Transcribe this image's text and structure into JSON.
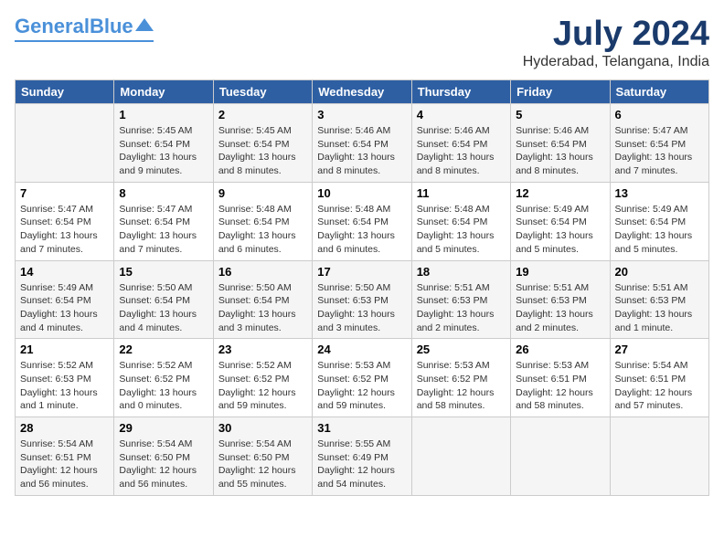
{
  "header": {
    "logo_general": "General",
    "logo_blue": "Blue",
    "month": "July 2024",
    "location": "Hyderabad, Telangana, India"
  },
  "columns": [
    "Sunday",
    "Monday",
    "Tuesday",
    "Wednesday",
    "Thursday",
    "Friday",
    "Saturday"
  ],
  "weeks": [
    [
      {
        "num": "",
        "info": ""
      },
      {
        "num": "1",
        "info": "Sunrise: 5:45 AM\nSunset: 6:54 PM\nDaylight: 13 hours\nand 9 minutes."
      },
      {
        "num": "2",
        "info": "Sunrise: 5:45 AM\nSunset: 6:54 PM\nDaylight: 13 hours\nand 8 minutes."
      },
      {
        "num": "3",
        "info": "Sunrise: 5:46 AM\nSunset: 6:54 PM\nDaylight: 13 hours\nand 8 minutes."
      },
      {
        "num": "4",
        "info": "Sunrise: 5:46 AM\nSunset: 6:54 PM\nDaylight: 13 hours\nand 8 minutes."
      },
      {
        "num": "5",
        "info": "Sunrise: 5:46 AM\nSunset: 6:54 PM\nDaylight: 13 hours\nand 8 minutes."
      },
      {
        "num": "6",
        "info": "Sunrise: 5:47 AM\nSunset: 6:54 PM\nDaylight: 13 hours\nand 7 minutes."
      }
    ],
    [
      {
        "num": "7",
        "info": "Sunrise: 5:47 AM\nSunset: 6:54 PM\nDaylight: 13 hours\nand 7 minutes."
      },
      {
        "num": "8",
        "info": "Sunrise: 5:47 AM\nSunset: 6:54 PM\nDaylight: 13 hours\nand 7 minutes."
      },
      {
        "num": "9",
        "info": "Sunrise: 5:48 AM\nSunset: 6:54 PM\nDaylight: 13 hours\nand 6 minutes."
      },
      {
        "num": "10",
        "info": "Sunrise: 5:48 AM\nSunset: 6:54 PM\nDaylight: 13 hours\nand 6 minutes."
      },
      {
        "num": "11",
        "info": "Sunrise: 5:48 AM\nSunset: 6:54 PM\nDaylight: 13 hours\nand 5 minutes."
      },
      {
        "num": "12",
        "info": "Sunrise: 5:49 AM\nSunset: 6:54 PM\nDaylight: 13 hours\nand 5 minutes."
      },
      {
        "num": "13",
        "info": "Sunrise: 5:49 AM\nSunset: 6:54 PM\nDaylight: 13 hours\nand 5 minutes."
      }
    ],
    [
      {
        "num": "14",
        "info": "Sunrise: 5:49 AM\nSunset: 6:54 PM\nDaylight: 13 hours\nand 4 minutes."
      },
      {
        "num": "15",
        "info": "Sunrise: 5:50 AM\nSunset: 6:54 PM\nDaylight: 13 hours\nand 4 minutes."
      },
      {
        "num": "16",
        "info": "Sunrise: 5:50 AM\nSunset: 6:54 PM\nDaylight: 13 hours\nand 3 minutes."
      },
      {
        "num": "17",
        "info": "Sunrise: 5:50 AM\nSunset: 6:53 PM\nDaylight: 13 hours\nand 3 minutes."
      },
      {
        "num": "18",
        "info": "Sunrise: 5:51 AM\nSunset: 6:53 PM\nDaylight: 13 hours\nand 2 minutes."
      },
      {
        "num": "19",
        "info": "Sunrise: 5:51 AM\nSunset: 6:53 PM\nDaylight: 13 hours\nand 2 minutes."
      },
      {
        "num": "20",
        "info": "Sunrise: 5:51 AM\nSunset: 6:53 PM\nDaylight: 13 hours\nand 1 minute."
      }
    ],
    [
      {
        "num": "21",
        "info": "Sunrise: 5:52 AM\nSunset: 6:53 PM\nDaylight: 13 hours\nand 1 minute."
      },
      {
        "num": "22",
        "info": "Sunrise: 5:52 AM\nSunset: 6:52 PM\nDaylight: 13 hours\nand 0 minutes."
      },
      {
        "num": "23",
        "info": "Sunrise: 5:52 AM\nSunset: 6:52 PM\nDaylight: 12 hours\nand 59 minutes."
      },
      {
        "num": "24",
        "info": "Sunrise: 5:53 AM\nSunset: 6:52 PM\nDaylight: 12 hours\nand 59 minutes."
      },
      {
        "num": "25",
        "info": "Sunrise: 5:53 AM\nSunset: 6:52 PM\nDaylight: 12 hours\nand 58 minutes."
      },
      {
        "num": "26",
        "info": "Sunrise: 5:53 AM\nSunset: 6:51 PM\nDaylight: 12 hours\nand 58 minutes."
      },
      {
        "num": "27",
        "info": "Sunrise: 5:54 AM\nSunset: 6:51 PM\nDaylight: 12 hours\nand 57 minutes."
      }
    ],
    [
      {
        "num": "28",
        "info": "Sunrise: 5:54 AM\nSunset: 6:51 PM\nDaylight: 12 hours\nand 56 minutes."
      },
      {
        "num": "29",
        "info": "Sunrise: 5:54 AM\nSunset: 6:50 PM\nDaylight: 12 hours\nand 56 minutes."
      },
      {
        "num": "30",
        "info": "Sunrise: 5:54 AM\nSunset: 6:50 PM\nDaylight: 12 hours\nand 55 minutes."
      },
      {
        "num": "31",
        "info": "Sunrise: 5:55 AM\nSunset: 6:49 PM\nDaylight: 12 hours\nand 54 minutes."
      },
      {
        "num": "",
        "info": ""
      },
      {
        "num": "",
        "info": ""
      },
      {
        "num": "",
        "info": ""
      }
    ]
  ]
}
